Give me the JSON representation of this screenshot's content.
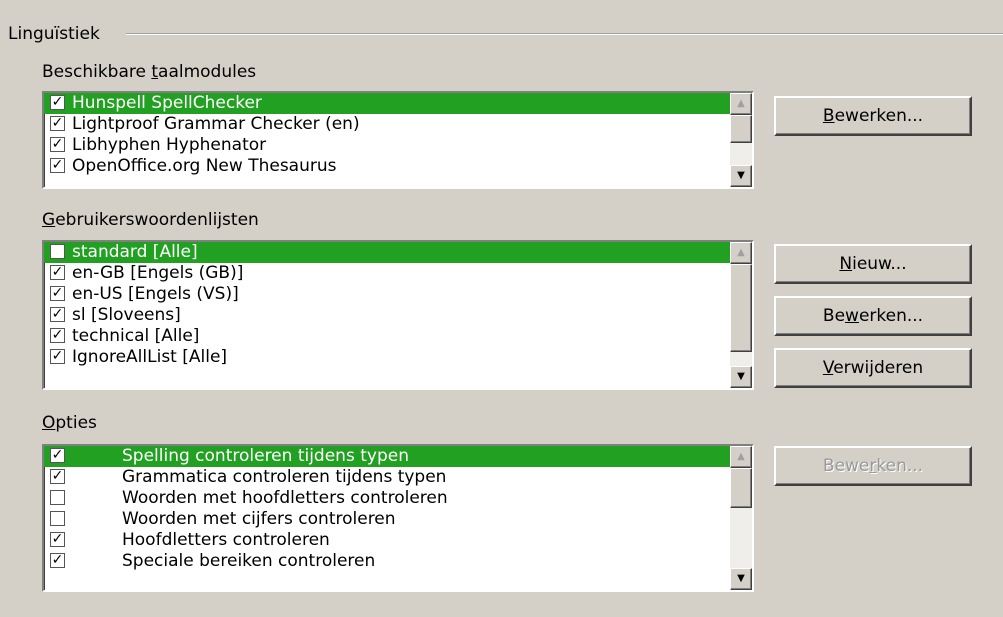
{
  "group": {
    "title": "Linguïstiek"
  },
  "modules": {
    "label_pre": "Beschikbare ",
    "label_ul": "t",
    "label_post": "aalmodules",
    "items": [
      {
        "label": "Hunspell SpellChecker",
        "checked": true,
        "selected": true
      },
      {
        "label": "Lightproof Grammar Checker (en)",
        "checked": true,
        "selected": false
      },
      {
        "label": "Libhyphen Hyphenator",
        "checked": true,
        "selected": false
      },
      {
        "label": "OpenOffice.org New Thesaurus",
        "checked": true,
        "selected": false
      }
    ],
    "edit_button": {
      "pre": "",
      "ul": "B",
      "post": "ewerken..."
    }
  },
  "dictionaries": {
    "label_ul": "G",
    "label_post": "ebruikerswoordenlijsten",
    "items": [
      {
        "label": "standard [Alle]",
        "checked": false,
        "selected": true
      },
      {
        "label": "en-GB [Engels (GB)]",
        "checked": true,
        "selected": false
      },
      {
        "label": "en-US [Engels (VS)]",
        "checked": true,
        "selected": false
      },
      {
        "label": "sl [Sloveens]",
        "checked": true,
        "selected": false
      },
      {
        "label": "technical [Alle]",
        "checked": true,
        "selected": false
      },
      {
        "label": "IgnoreAllList [Alle]",
        "checked": true,
        "selected": false
      }
    ],
    "new_button": {
      "pre": "",
      "ul": "N",
      "post": "ieuw..."
    },
    "edit_button": {
      "pre": "Be",
      "ul": "w",
      "post": "erken..."
    },
    "delete_button": {
      "pre": "",
      "ul": "V",
      "post": "erwijderen"
    }
  },
  "options": {
    "label_ul": "O",
    "label_post": "pties",
    "items": [
      {
        "label": "Spelling controleren tijdens typen",
        "checked": true,
        "selected": true
      },
      {
        "label": "Grammatica controleren tijdens typen",
        "checked": true,
        "selected": false
      },
      {
        "label": "Woorden met hoofdletters controleren",
        "checked": false,
        "selected": false
      },
      {
        "label": "Woorden met cijfers controleren",
        "checked": false,
        "selected": false
      },
      {
        "label": "Hoofdletters controleren",
        "checked": true,
        "selected": false
      },
      {
        "label": "Speciale bereiken controleren",
        "checked": true,
        "selected": false
      }
    ],
    "edit_button": {
      "pre": "Bewe",
      "ul": "r",
      "post": "ken..."
    }
  },
  "colors": {
    "selection": "#22a022",
    "dialog": "#d4d0c8"
  }
}
